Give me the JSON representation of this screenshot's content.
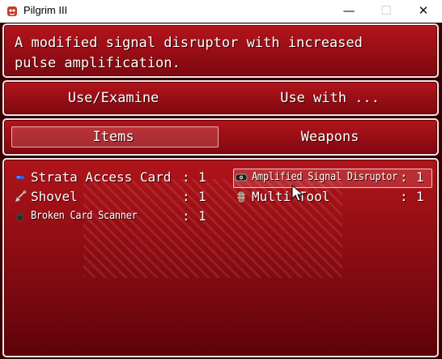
{
  "window": {
    "title": "Pilgrim III",
    "minimize_glyph": "—",
    "maximize_glyph": "☐",
    "close_glyph": "✕"
  },
  "help": {
    "text": "A modified signal disruptor with increased\npulse amplification."
  },
  "commands": {
    "use_examine": "Use/Examine",
    "use_with": "Use with ..."
  },
  "categories": {
    "items": "Items",
    "weapons": "Weapons",
    "selected": "Items"
  },
  "inventory": [
    {
      "name": "Strata Access Card",
      "sep": ":",
      "qty": "1",
      "icon": "card-icon"
    },
    {
      "name": "Shovel",
      "sep": ":",
      "qty": "1",
      "icon": "shovel-icon"
    },
    {
      "name": "Broken Card Scanner",
      "sep": ":",
      "qty": "1",
      "icon": "scanner-icon"
    },
    {
      "name": "Amplified Signal Disruptor",
      "sep": ":",
      "qty": "1",
      "icon": "disruptor-icon",
      "selected": true
    },
    {
      "name": "Multi Tool",
      "sep": ":",
      "qty": "1",
      "icon": "multitool-icon"
    }
  ],
  "colors": {
    "panel_top": "#b4141c",
    "panel_bottom": "#7e0810",
    "border": "#f3e6e6",
    "text": "#ffffff"
  }
}
